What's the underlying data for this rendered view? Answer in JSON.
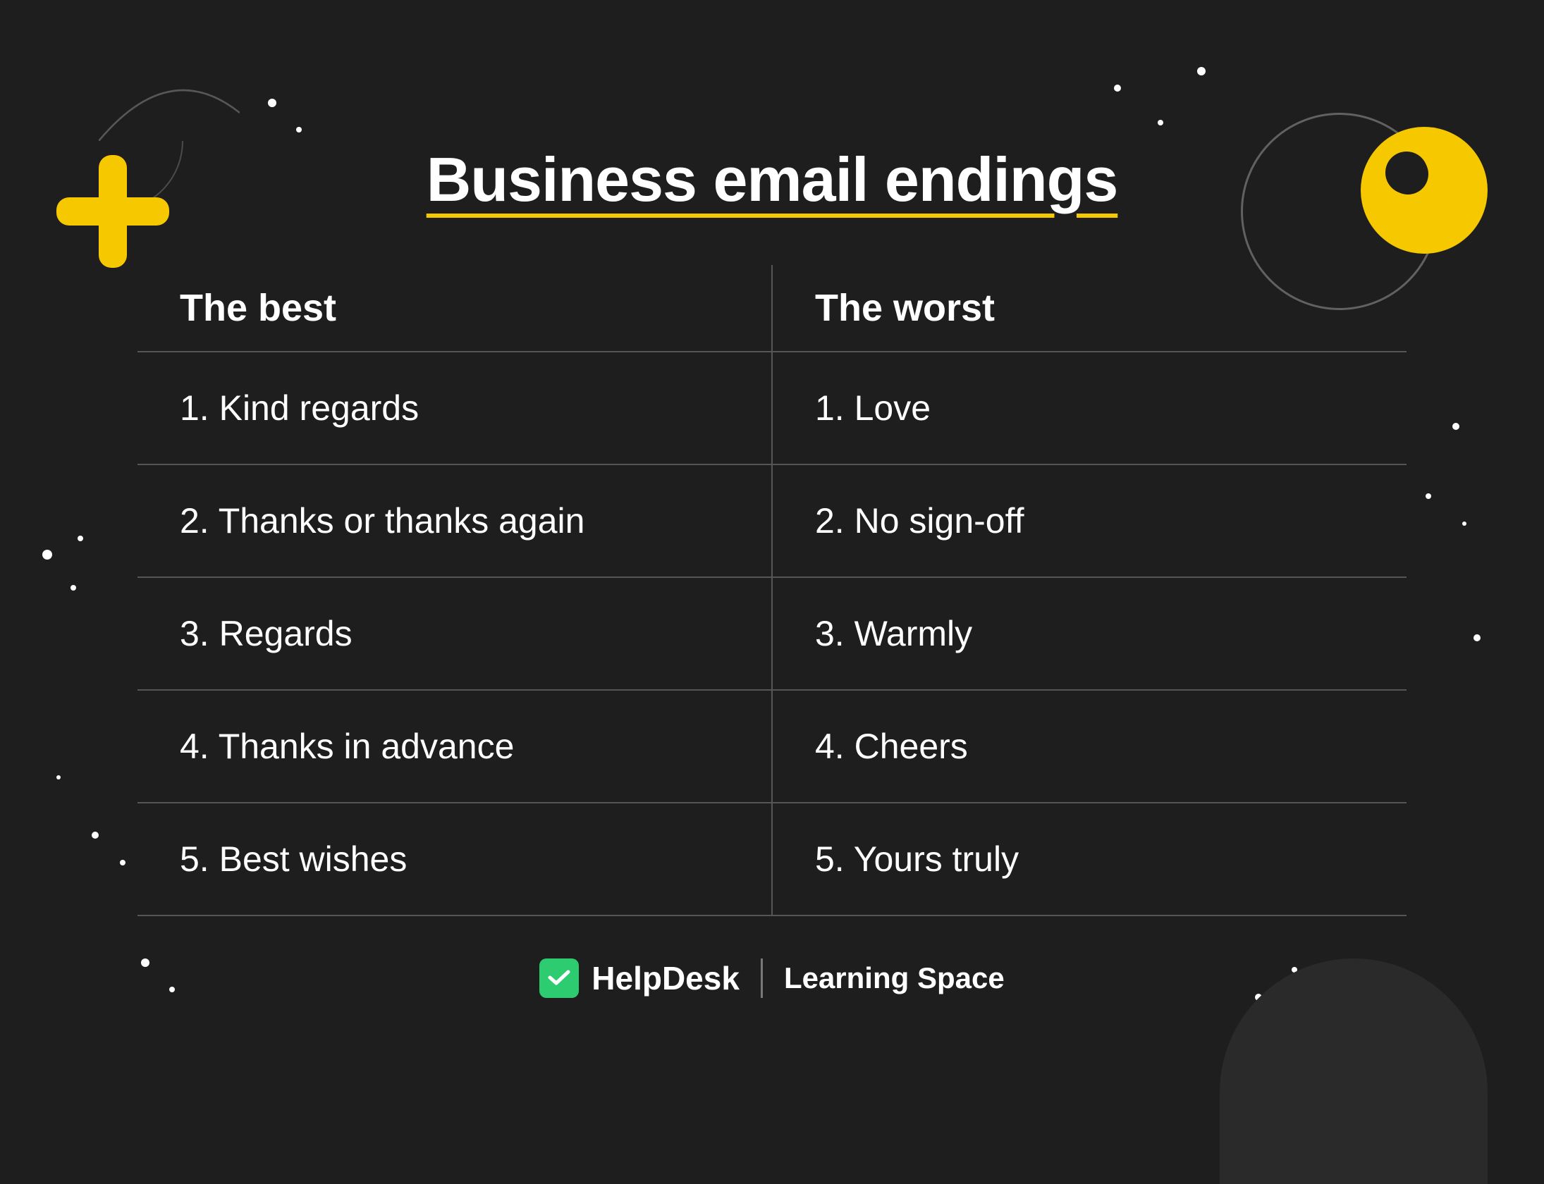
{
  "title": "Business email endings",
  "columns": {
    "best_header": "The best",
    "worst_header": "The worst"
  },
  "rows": [
    {
      "best": "1. Kind regards",
      "worst": "1. Love"
    },
    {
      "best": "2. Thanks or thanks again",
      "worst": "2. No sign-off"
    },
    {
      "best": "3. Regards",
      "worst": "3. Warmly"
    },
    {
      "best": "4. Thanks in advance",
      "worst": "4. Cheers"
    },
    {
      "best": "5. Best wishes",
      "worst": "5. Yours truly"
    }
  ],
  "footer": {
    "brand": "HelpDesk",
    "subtitle": "Learning Space"
  },
  "colors": {
    "background": "#1e1e1e",
    "accent": "#f5c800",
    "text": "#ffffff",
    "divider": "rgba(255,255,255,0.25)",
    "green": "#2ecc71"
  }
}
